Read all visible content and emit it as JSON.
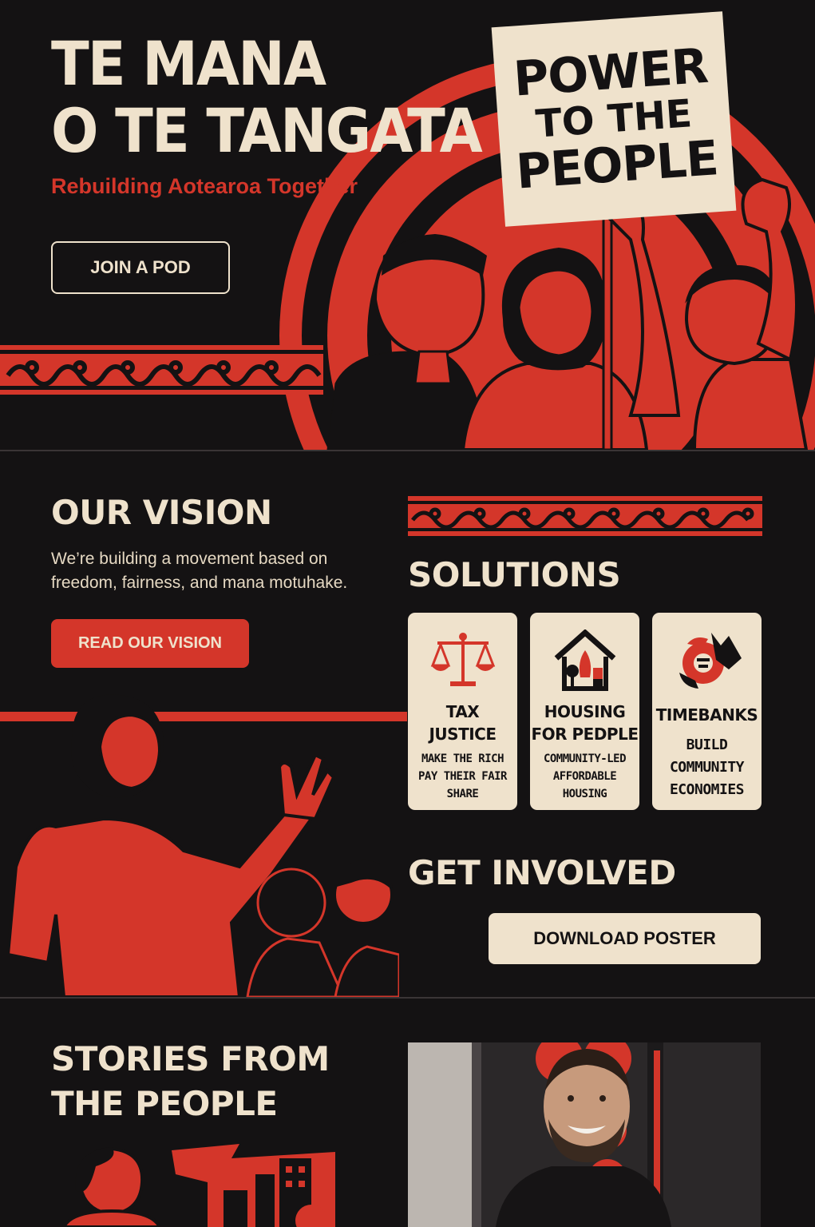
{
  "hero": {
    "title_line1": "TE MANA",
    "title_line2": "O TE TANGATA",
    "subtitle": "Rebuilding Aotearoa Together",
    "cta": "JOIN A POD",
    "sign_line1": "POWER",
    "sign_line2": "TO THE",
    "sign_line3": "PEOPLE"
  },
  "vision": {
    "title": "OUR VISION",
    "text": "We’re building a movement based on freedom, fairness, and mana motuhake.",
    "cta": "READ OUR VISION"
  },
  "solutions": {
    "title": "SOLUTIONS",
    "cards": [
      {
        "icon": "scales-icon",
        "title_line1": "TAX",
        "title_line2": "JUSTICE",
        "desc_line1": "MAKE THE RICH",
        "desc_line2": "PAY THEIR FAIR",
        "desc_line3": "SHARE"
      },
      {
        "icon": "house-icon",
        "title_line1": "HOUSING",
        "title_line2": "FOR PEDPLE",
        "desc_line1": "COMMUNITY-LED",
        "desc_line2": "AFFORDABLE",
        "desc_line3": "HOUSING"
      },
      {
        "icon": "hands-icon",
        "title_line1": "TIMEBANKS",
        "desc_line1": "BUILD",
        "desc_line2": "COMMUNITY",
        "desc_line3": "ECONOMIES"
      }
    ]
  },
  "involved": {
    "title": "GET INVOLVED",
    "cta": "DOWNLOAD POSTER"
  },
  "stories": {
    "title_line1": "STORIES FROM",
    "title_line2": "THE PEOPLE"
  },
  "colors": {
    "background": "#141213",
    "accent_red": "#d4362a",
    "cream": "#efe2cc"
  }
}
